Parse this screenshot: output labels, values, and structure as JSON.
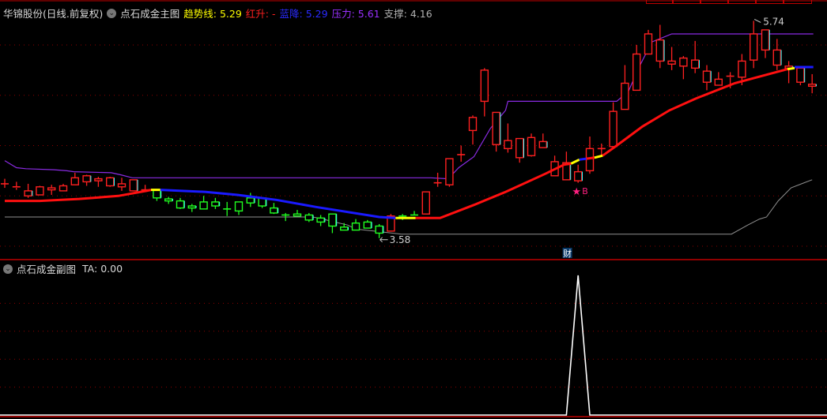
{
  "main_header": {
    "stock": "华锦股份(日线.前复权)",
    "indicator": "点石成金主图",
    "trend_label": "趋势线:",
    "trend_value": "5.29",
    "rise_label": "红升:",
    "rise_value": "-",
    "fall_label": "蓝降:",
    "fall_value": "5.29",
    "resist_label": "压力:",
    "resist_value": "5.61",
    "support_label": "支撑:",
    "support_value": "4.16"
  },
  "sub_header": {
    "indicator": "点石成金副图",
    "ta_label": "TA:",
    "ta_value": "0.00"
  },
  "colors": {
    "up": "#ff2020",
    "down_edge": "#40ffff",
    "green": "#20ff20",
    "trend_red": "#ff1010",
    "trend_blue": "#1a1aff",
    "trend_yellow": "#ffff00",
    "resist": "#8a2be2",
    "support": "#909090",
    "signal": "#ff2080",
    "grid": "#900000"
  },
  "chart_data": [
    {
      "type": "candlestick",
      "title": "点石成金主图",
      "ylim": [
        3.45,
        5.95
      ],
      "y_gridlines": [
        5.5,
        5.0,
        4.5,
        4.0,
        3.5
      ],
      "candles_ohlc": [
        [
          4.12,
          4.17,
          4.08,
          4.12
        ],
        [
          4.09,
          4.14,
          4.06,
          4.08
        ],
        [
          4.05,
          4.12,
          3.98,
          4.0
        ],
        [
          4.01,
          4.1,
          4.01,
          4.09
        ],
        [
          4.06,
          4.11,
          4.01,
          4.08
        ],
        [
          4.05,
          4.12,
          4.05,
          4.1
        ],
        [
          4.11,
          4.23,
          4.11,
          4.18
        ],
        [
          4.2,
          4.21,
          4.1,
          4.14
        ],
        [
          4.15,
          4.19,
          4.09,
          4.17
        ],
        [
          4.18,
          4.19,
          4.09,
          4.1
        ],
        [
          4.09,
          4.18,
          4.05,
          4.12
        ],
        [
          4.16,
          4.16,
          4.05,
          4.05
        ],
        [
          4.05,
          4.11,
          4.04,
          4.06
        ],
        [
          4.06,
          4.06,
          3.95,
          3.98
        ],
        [
          3.97,
          3.99,
          3.92,
          3.95
        ],
        [
          3.95,
          3.98,
          3.87,
          3.88
        ],
        [
          3.9,
          3.92,
          3.84,
          3.88
        ],
        [
          3.87,
          4.0,
          3.87,
          3.94
        ],
        [
          3.94,
          3.98,
          3.87,
          3.9
        ],
        [
          3.87,
          3.94,
          3.8,
          3.87
        ],
        [
          3.85,
          3.94,
          3.81,
          3.94
        ],
        [
          3.98,
          4.03,
          3.89,
          3.93
        ],
        [
          3.98,
          3.98,
          3.88,
          3.9
        ],
        [
          3.88,
          3.93,
          3.82,
          3.83
        ],
        [
          3.81,
          3.83,
          3.75,
          3.81
        ],
        [
          3.8,
          3.86,
          3.8,
          3.82
        ],
        [
          3.81,
          3.83,
          3.74,
          3.76
        ],
        [
          3.78,
          3.81,
          3.7,
          3.74
        ],
        [
          3.82,
          3.82,
          3.63,
          3.7
        ],
        [
          3.69,
          3.73,
          3.66,
          3.66
        ],
        [
          3.66,
          3.77,
          3.66,
          3.73
        ],
        [
          3.74,
          3.76,
          3.68,
          3.68
        ],
        [
          3.7,
          3.72,
          3.58,
          3.63
        ],
        [
          3.65,
          3.82,
          3.65,
          3.8
        ],
        [
          3.8,
          3.82,
          3.76,
          3.8
        ],
        [
          3.8,
          3.85,
          3.8,
          3.81
        ],
        [
          3.82,
          4.04,
          3.82,
          4.04
        ],
        [
          4.13,
          4.23,
          4.09,
          4.13
        ],
        [
          4.11,
          4.37,
          4.09,
          4.37
        ],
        [
          4.41,
          4.5,
          4.34,
          4.41
        ],
        [
          4.65,
          4.8,
          4.51,
          4.78
        ],
        [
          4.94,
          5.27,
          4.79,
          5.25
        ],
        [
          4.83,
          4.83,
          4.44,
          4.51
        ],
        [
          4.47,
          4.72,
          4.43,
          4.55
        ],
        [
          4.57,
          4.57,
          4.33,
          4.38
        ],
        [
          4.4,
          4.62,
          4.39,
          4.58
        ],
        [
          4.54,
          4.62,
          4.48,
          4.48
        ],
        [
          4.2,
          4.4,
          4.2,
          4.34
        ],
        [
          4.33,
          4.44,
          4.16,
          4.16
        ],
        [
          4.24,
          4.31,
          4.13,
          4.15
        ],
        [
          4.25,
          4.59,
          4.22,
          4.47
        ],
        [
          4.47,
          4.52,
          4.39,
          4.47
        ],
        [
          4.49,
          4.93,
          4.49,
          4.84
        ],
        [
          4.86,
          5.3,
          4.86,
          5.12
        ],
        [
          5.05,
          5.5,
          5.05,
          5.41
        ],
        [
          5.41,
          5.65,
          5.41,
          5.61
        ],
        [
          5.55,
          5.7,
          5.27,
          5.34
        ],
        [
          5.31,
          5.48,
          5.25,
          5.34
        ],
        [
          5.29,
          5.39,
          5.16,
          5.37
        ],
        [
          5.35,
          5.54,
          5.22,
          5.27
        ],
        [
          5.24,
          5.3,
          5.05,
          5.13
        ],
        [
          5.1,
          5.23,
          5.1,
          5.16
        ],
        [
          5.18,
          5.23,
          5.07,
          5.19
        ],
        [
          5.18,
          5.41,
          5.1,
          5.34
        ],
        [
          5.35,
          5.74,
          5.27,
          5.61
        ],
        [
          5.65,
          5.65,
          5.37,
          5.45
        ],
        [
          5.45,
          5.56,
          5.25,
          5.3
        ],
        [
          5.29,
          5.34,
          5.12,
          5.27
        ],
        [
          5.27,
          5.27,
          5.1,
          5.13
        ],
        [
          5.11,
          5.21,
          5.02,
          5.09
        ]
      ],
      "green_candle_indices": [
        13,
        14,
        15,
        16,
        17,
        18,
        19,
        20,
        21,
        22,
        23,
        24,
        25,
        26,
        27,
        28,
        29,
        30,
        31,
        32,
        34,
        35
      ],
      "trend_segments": [
        {
          "color": "red",
          "points": [
            [
              0,
              3.95
            ],
            [
              3,
              3.95
            ],
            [
              6.35,
              3.97
            ],
            [
              9.7,
              4.0
            ],
            [
              12.1,
              4.05
            ],
            [
              12.5,
              4.06
            ]
          ]
        },
        {
          "color": "yellow",
          "points": [
            [
              12.5,
              4.06
            ],
            [
              13.3,
              4.06
            ]
          ]
        },
        {
          "color": "blue",
          "points": [
            [
              13.3,
              4.06
            ],
            [
              17.2,
              4.04
            ],
            [
              19.9,
              4.01
            ],
            [
              23.2,
              3.96
            ],
            [
              26.6,
              3.89
            ],
            [
              32,
              3.79
            ],
            [
              33.4,
              3.78
            ]
          ]
        },
        {
          "color": "yellow",
          "points": [
            [
              33.4,
              3.78
            ],
            [
              35.1,
              3.78
            ]
          ]
        },
        {
          "color": "red",
          "points": [
            [
              35.1,
              3.78
            ],
            [
              37.2,
              3.78
            ],
            [
              40.1,
              3.91
            ],
            [
              42.8,
              4.04
            ],
            [
              46.2,
              4.22
            ],
            [
              47.8,
              4.31
            ],
            [
              48.4,
              4.32
            ]
          ]
        },
        {
          "color": "yellow",
          "points": [
            [
              48.4,
              4.32
            ],
            [
              49.1,
              4.36
            ]
          ]
        },
        {
          "color": "blue",
          "points": [
            [
              49.1,
              4.36
            ],
            [
              49.7,
              4.37
            ]
          ]
        },
        {
          "color": "red",
          "points": [
            [
              49.7,
              4.37
            ],
            [
              50.4,
              4.38
            ]
          ]
        },
        {
          "color": "yellow",
          "points": [
            [
              50.4,
              4.38
            ],
            [
              51.1,
              4.4
            ]
          ]
        },
        {
          "color": "red",
          "points": [
            [
              51.1,
              4.4
            ],
            [
              52.3,
              4.5
            ],
            [
              54.5,
              4.69
            ],
            [
              56.8,
              4.85
            ],
            [
              59.1,
              4.97
            ],
            [
              62.4,
              5.12
            ],
            [
              66.9,
              5.26
            ]
          ]
        },
        {
          "color": "yellow",
          "points": [
            [
              66.9,
              5.26
            ],
            [
              67.5,
              5.27
            ]
          ]
        },
        {
          "color": "blue",
          "points": [
            [
              67.5,
              5.28
            ],
            [
              69.1,
              5.28
            ]
          ]
        }
      ],
      "resistance_line": [
        [
          0,
          4.35
        ],
        [
          1,
          4.28
        ],
        [
          1.8,
          4.27
        ],
        [
          4.2,
          4.26
        ],
        [
          5.3,
          4.25
        ],
        [
          5.9,
          4.24
        ],
        [
          9.1,
          4.23
        ],
        [
          9.9,
          4.21
        ],
        [
          10.9,
          4.18
        ],
        [
          36.4,
          4.18
        ],
        [
          37.9,
          4.17
        ],
        [
          38.8,
          4.28
        ],
        [
          40.1,
          4.39
        ],
        [
          41.5,
          4.67
        ],
        [
          42.8,
          4.85
        ],
        [
          43.0,
          4.94
        ],
        [
          52.3,
          4.94
        ],
        [
          53.3,
          5.04
        ],
        [
          54.3,
          5.3
        ],
        [
          55.3,
          5.53
        ],
        [
          57,
          5.61
        ],
        [
          69.1,
          5.61
        ]
      ],
      "support_line": [
        [
          0,
          3.79
        ],
        [
          26.3,
          3.79
        ],
        [
          26.8,
          3.78
        ],
        [
          28.2,
          3.74
        ],
        [
          29.3,
          3.71
        ],
        [
          30,
          3.67
        ],
        [
          31.6,
          3.65
        ],
        [
          33.9,
          3.62
        ],
        [
          62.1,
          3.62
        ],
        [
          63.5,
          3.71
        ],
        [
          64.5,
          3.77
        ],
        [
          65.1,
          3.79
        ],
        [
          66.1,
          3.95
        ],
        [
          67.2,
          4.08
        ],
        [
          69,
          4.16
        ]
      ],
      "annotations": [
        {
          "text": "5.74",
          "candle": 64,
          "price": 5.74,
          "kind": "high-marker"
        },
        {
          "text": "3.58",
          "candle": 32,
          "price": 3.58,
          "kind": "low-marker"
        },
        {
          "text": "B",
          "candle": 49,
          "kind": "buy-signal-star"
        },
        {
          "text": "财",
          "candle": 47,
          "kind": "financial-report-marker"
        }
      ]
    },
    {
      "type": "line",
      "title": "点石成金副图",
      "series": [
        {
          "name": "TA",
          "values_nonzero": [
            [
              49,
              100
            ]
          ],
          "default": 0
        }
      ],
      "ylim": [
        0,
        100
      ],
      "y_gridlines": [
        20,
        40,
        60,
        80
      ]
    }
  ]
}
